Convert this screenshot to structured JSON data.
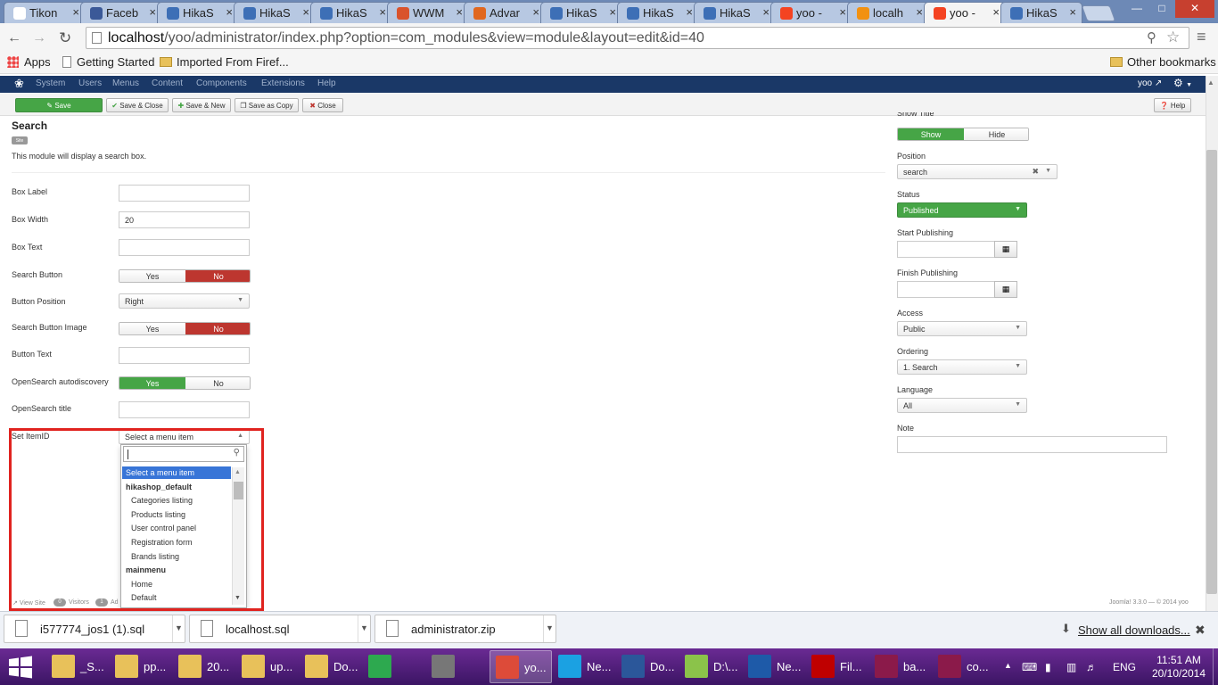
{
  "browser": {
    "tabs": [
      {
        "label": "Tikon",
        "icon": "page-icon",
        "color": "#ffffff"
      },
      {
        "label": "Faceb",
        "icon": "facebook-icon",
        "color": "#3b5998"
      },
      {
        "label": "HikaS",
        "icon": "joomla-icon",
        "color": "#3d6fb6"
      },
      {
        "label": "HikaS",
        "icon": "joomla-icon",
        "color": "#3d6fb6"
      },
      {
        "label": "HikaS",
        "icon": "joomla-icon",
        "color": "#3d6fb6"
      },
      {
        "label": "WWM",
        "icon": "wwm-icon",
        "color": "#d9532c"
      },
      {
        "label": "Advar",
        "icon": "advanced-icon",
        "color": "#e0671f"
      },
      {
        "label": "HikaS",
        "icon": "joomla-icon",
        "color": "#3d6fb6"
      },
      {
        "label": "HikaS",
        "icon": "joomla-icon",
        "color": "#3d6fb6"
      },
      {
        "label": "HikaS",
        "icon": "joomla-icon",
        "color": "#3d6fb6"
      },
      {
        "label": "yoo -",
        "icon": "joomla-multicolor-icon",
        "color": "#f44321"
      },
      {
        "label": "localh",
        "icon": "phpmyadmin-icon",
        "color": "#f29111"
      },
      {
        "label": "yoo -",
        "icon": "joomla-multicolor-icon",
        "color": "#f44321",
        "active": true
      },
      {
        "label": "HikaS",
        "icon": "joomla-icon",
        "color": "#3d6fb6"
      }
    ],
    "url_host": "localhost",
    "url_path": "/yoo/administrator/index.php?option=com_modules&view=module&layout=edit&id=40",
    "bookmarks": {
      "apps": "Apps",
      "getting_started": "Getting Started",
      "imported": "Imported From Firef...",
      "other": "Other bookmarks"
    }
  },
  "joomla": {
    "menu": [
      "System",
      "Users",
      "Menus",
      "Content",
      "Components",
      "Extensions",
      "Help"
    ],
    "user": "yoo",
    "toolbar": {
      "save": "Save",
      "save_close": "Save & Close",
      "save_new": "Save & New",
      "save_copy": "Save as Copy",
      "close": "Close",
      "help": "Help"
    },
    "module_title": "Search",
    "module_badge": "Site",
    "module_desc": "This module will display a search box.",
    "fields": {
      "box_label": "Box Label",
      "box_width": "Box Width",
      "box_width_value": "20",
      "box_text": "Box Text",
      "search_button": "Search Button",
      "button_position": "Button Position",
      "button_position_value": "Right",
      "search_button_image": "Search Button Image",
      "button_text": "Button Text",
      "opensearch_autodiscovery": "OpenSearch autodiscovery",
      "opensearch_title": "OpenSearch title",
      "set_itemid": "Set ItemID",
      "set_itemid_value": "Select a menu item",
      "yes": "Yes",
      "no": "No"
    },
    "dropdown": {
      "options": [
        {
          "label": "Select a menu item",
          "kind": "highlighted"
        },
        {
          "label": "hikashop_default",
          "kind": "group"
        },
        {
          "label": "Categories listing",
          "kind": "item"
        },
        {
          "label": "Products listing",
          "kind": "item"
        },
        {
          "label": "User control panel",
          "kind": "item"
        },
        {
          "label": "Registration form",
          "kind": "item"
        },
        {
          "label": "Brands listing",
          "kind": "item"
        },
        {
          "label": "mainmenu",
          "kind": "group"
        },
        {
          "label": "Home",
          "kind": "item"
        },
        {
          "label": "Default",
          "kind": "item"
        }
      ]
    },
    "right": {
      "show_title_label": "Show Title",
      "show": "Show",
      "hide": "Hide",
      "position_label": "Position",
      "position_value": "search",
      "status_label": "Status",
      "status_value": "Published",
      "start_publishing": "Start Publishing",
      "finish_publishing": "Finish Publishing",
      "access_label": "Access",
      "access_value": "Public",
      "ordering_label": "Ordering",
      "ordering_value": "1. Search",
      "language_label": "Language",
      "language_value": "All",
      "note_label": "Note"
    },
    "footer": {
      "view_site": "View Site",
      "visitors_count": "0",
      "visitors": "Visitors",
      "admin_count": "1",
      "admin": "Ad",
      "version": "Joomla! 3.3.0 — © 2014 yoo"
    },
    "colors": {
      "green": "#46a546",
      "red": "#bd362f",
      "navbar": "#1a3867",
      "highlight": "#3875d7"
    }
  },
  "downloads": {
    "items": [
      "i577774_jos1 (1).sql",
      "localhost.sql",
      "administrator.zip"
    ],
    "show_all": "Show all downloads..."
  },
  "taskbar": {
    "items": [
      {
        "label": "_S...",
        "icon": "folder-icon",
        "color": "#e8c15a"
      },
      {
        "label": "pp...",
        "icon": "folder-icon",
        "color": "#e8c15a"
      },
      {
        "label": "20...",
        "icon": "folder-icon",
        "color": "#e8c15a"
      },
      {
        "label": "up...",
        "icon": "folder-icon",
        "color": "#e8c15a"
      },
      {
        "label": "Do...",
        "icon": "downloads-folder-icon",
        "color": "#e8c15a"
      },
      {
        "label": "",
        "icon": "store-icon",
        "color": "#2da94f"
      },
      {
        "label": "",
        "icon": "scanner-icon",
        "color": "#777777"
      },
      {
        "label": "yo...",
        "icon": "chrome-icon",
        "color": "#dd4b39",
        "active": true
      },
      {
        "label": "Ne...",
        "icon": "ie-icon",
        "color": "#1ba1e2"
      },
      {
        "label": "Do...",
        "icon": "word-icon",
        "color": "#2b579a"
      },
      {
        "label": "D:\\...",
        "icon": "notepad-icon",
        "color": "#8bc34a"
      },
      {
        "label": "Ne...",
        "icon": "network-icon",
        "color": "#1e5aa8"
      },
      {
        "label": "Fil...",
        "icon": "filezilla-icon",
        "color": "#bf0000"
      },
      {
        "label": "ba...",
        "icon": "winrar-icon",
        "color": "#8b1a4a"
      },
      {
        "label": "co...",
        "icon": "winrar-icon",
        "color": "#8b1a4a"
      }
    ],
    "lang": "ENG",
    "time": "11:51 AM",
    "date": "20/10/2014"
  }
}
